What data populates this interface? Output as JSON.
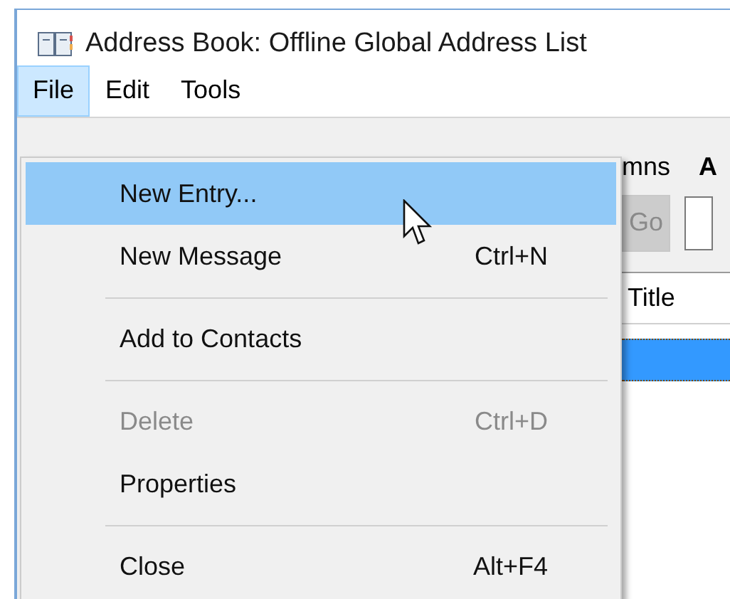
{
  "window": {
    "title": "Address Book: Offline Global Address List"
  },
  "menubar": [
    {
      "label": "File",
      "selected": true
    },
    {
      "label": "Edit",
      "selected": false
    },
    {
      "label": "Tools",
      "selected": false
    }
  ],
  "menu": [
    {
      "kind": "item",
      "label": "New Entry...",
      "selected": true,
      "disabled": false
    },
    {
      "kind": "item",
      "label": "New Message",
      "shortcut": "Ctrl+N",
      "selected": false,
      "disabled": false
    },
    {
      "kind": "separator"
    },
    {
      "kind": "item",
      "label": "Add to Contacts",
      "selected": false,
      "disabled": false
    },
    {
      "kind": "separator"
    },
    {
      "kind": "item",
      "label": "Delete",
      "shortcut": "Ctrl+D",
      "selected": false,
      "disabled": true
    },
    {
      "kind": "item",
      "label": "Properties",
      "selected": false,
      "disabled": false
    },
    {
      "kind": "separator"
    },
    {
      "kind": "item",
      "label": "Close",
      "shortcut": "Alt+F4",
      "selected": false,
      "disabled": false
    }
  ],
  "background": {
    "option_label": "mns",
    "search_label": "A",
    "go_button": {
      "label": "Go",
      "disabled": true
    },
    "columns": [
      "Title"
    ],
    "rows": [
      {
        "selected": true
      }
    ]
  }
}
